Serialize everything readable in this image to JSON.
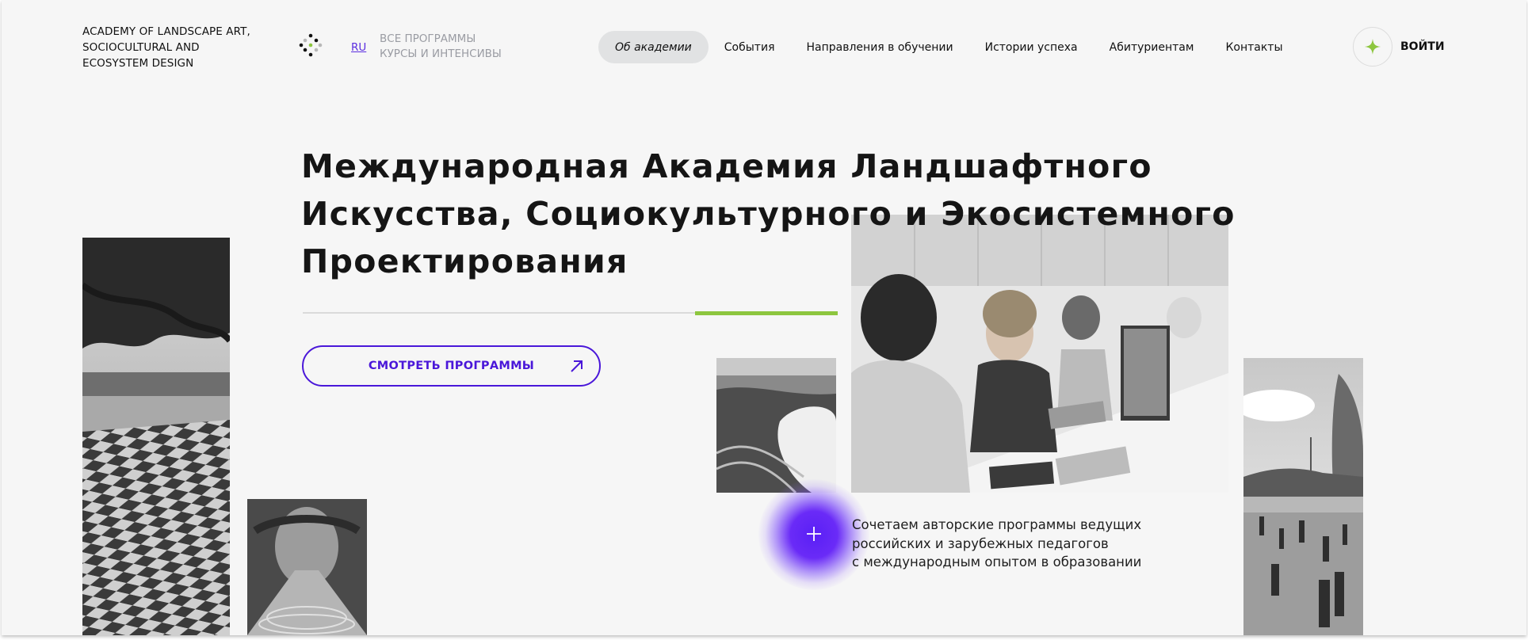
{
  "header": {
    "brand_lines": [
      "ACADEMY OF LANDSCAPE ART,",
      "SOCIOCULTURAL AND",
      "ECOSYSTEM DESIGN"
    ],
    "lang": "RU",
    "all_programs_lines": [
      "ВСЕ ПРОГРАММЫ",
      "КУРСЫ И ИНТЕНСИВЫ"
    ],
    "nav": [
      {
        "label": "Об академии",
        "active": true
      },
      {
        "label": "События",
        "active": false
      },
      {
        "label": "Направления в обучении",
        "active": false
      },
      {
        "label": "Истории успеха",
        "active": false
      },
      {
        "label": "Абитуриентам",
        "active": false
      },
      {
        "label": "Контакты",
        "active": false
      }
    ],
    "login_label": "ВОЙТИ",
    "login_icon": "sparkle-star-icon"
  },
  "hero": {
    "title_lines": [
      "Международная Академия Ландшафтного",
      "Искусства, Социокультурного и Экосистемного",
      "Проектирования"
    ],
    "cta_label": "СМОТРЕТЬ ПРОГРАММЫ",
    "cta_icon": "arrow-up-right-icon",
    "plus_icon": "plus-icon",
    "caption_lines": [
      "Сочетаем авторские программы ведущих",
      "российских и зарубежных педагогов",
      "с международным опытом в образовании"
    ]
  },
  "colors": {
    "accent_purple": "#4a17d9",
    "accent_green": "#8dc63f",
    "background": "#f6f6f6",
    "nav_active_bg": "#e1e2e3"
  }
}
